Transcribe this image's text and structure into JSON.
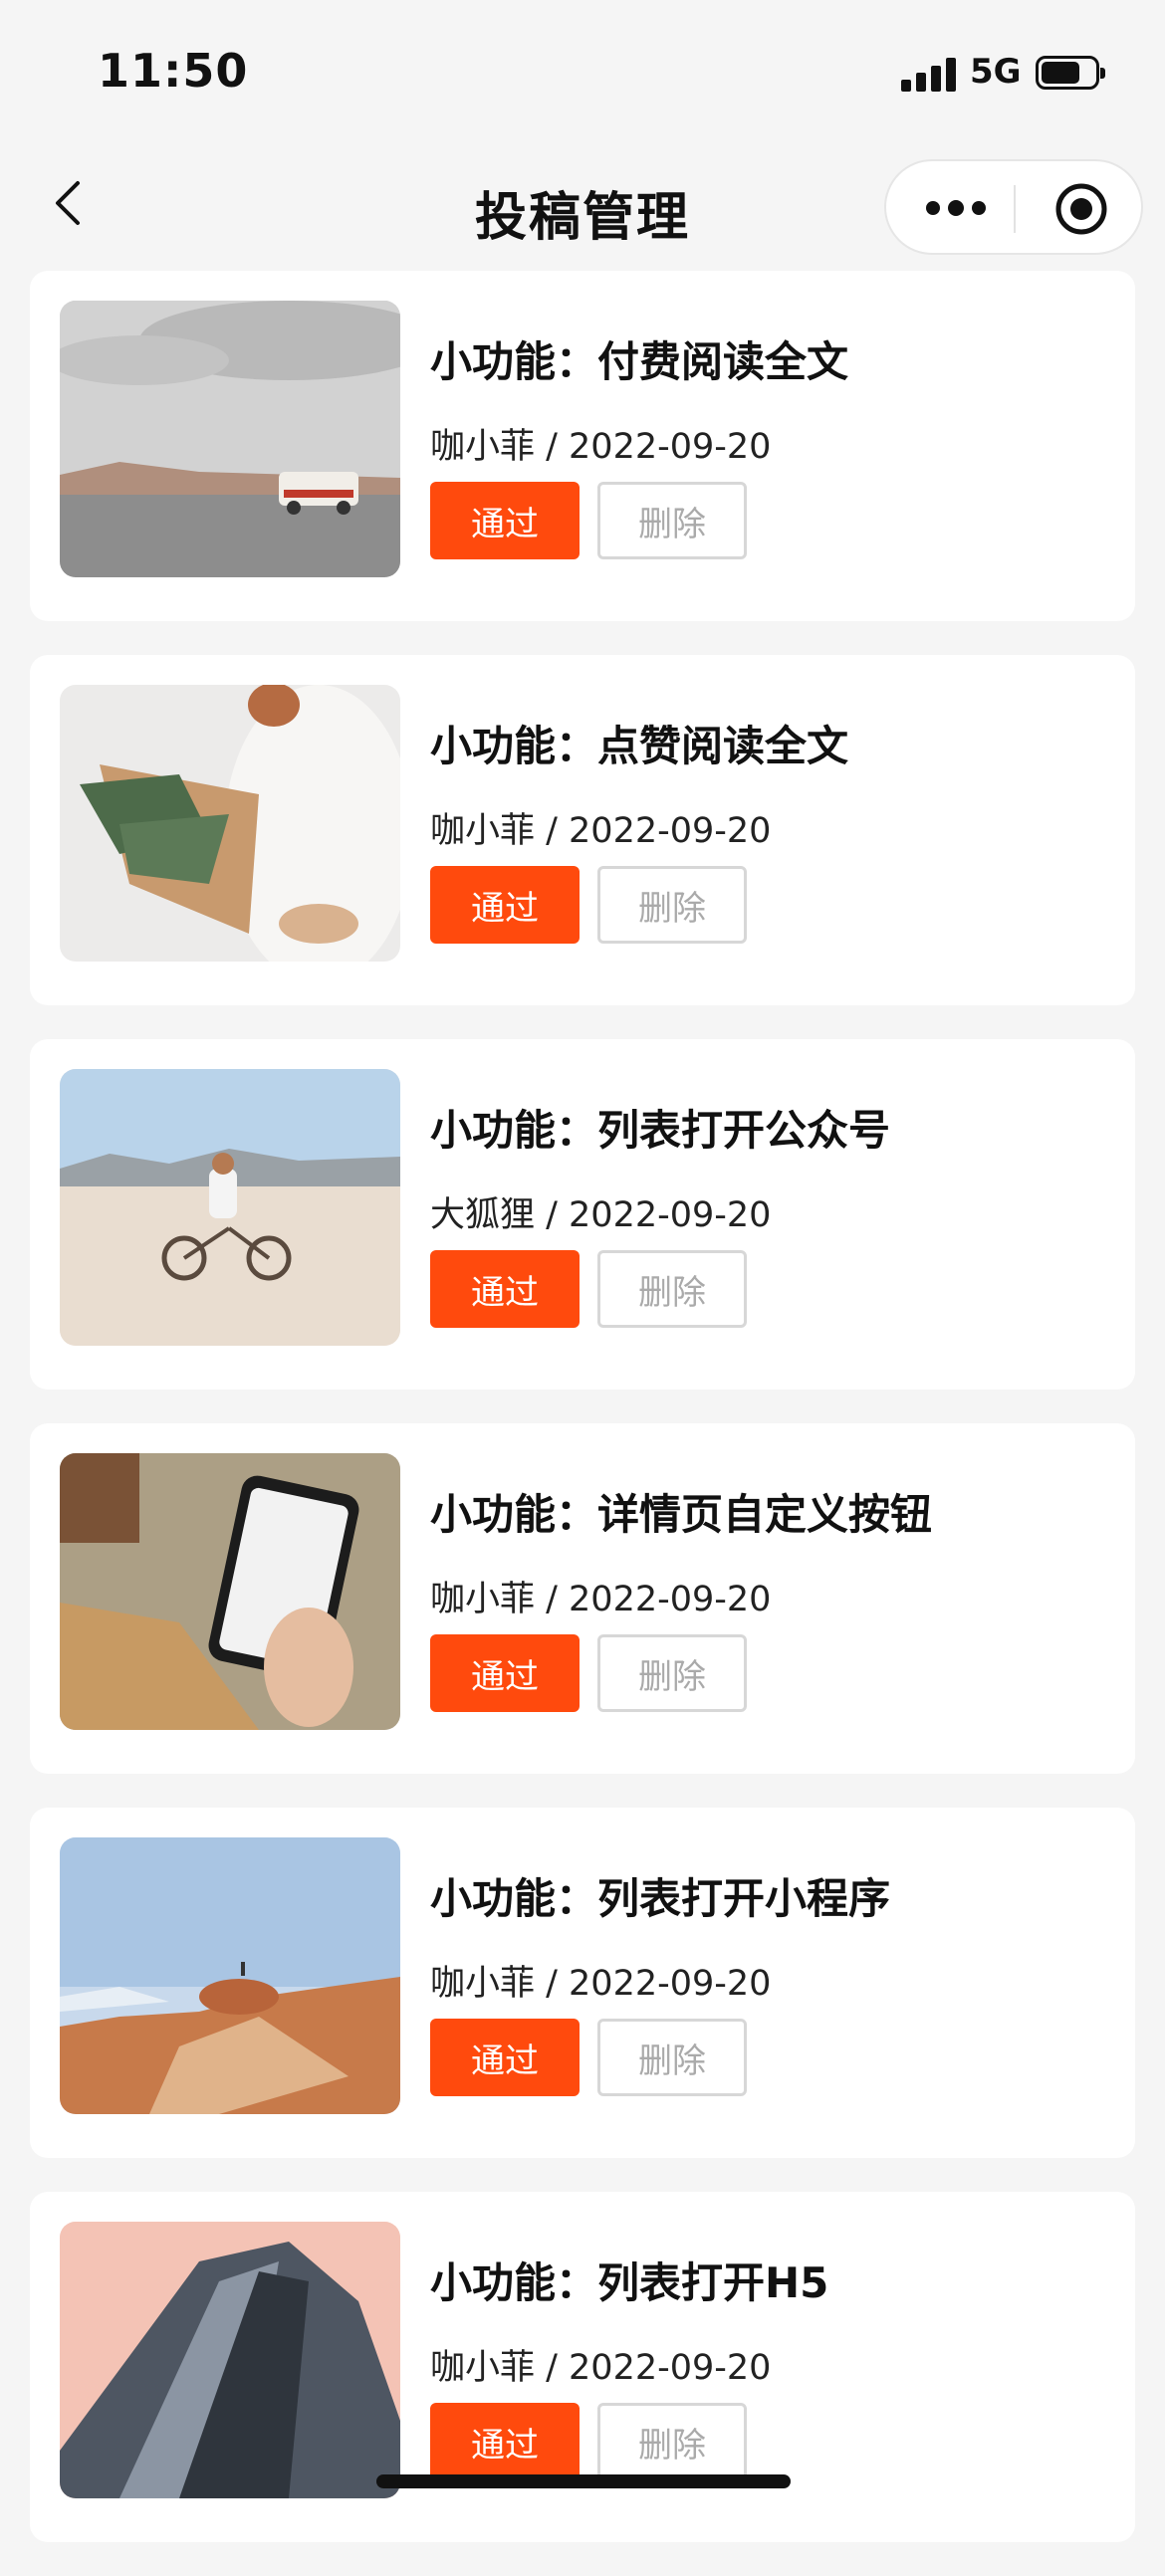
{
  "status_bar": {
    "time": "11:50",
    "network": "5G"
  },
  "nav": {
    "title": "投稿管理"
  },
  "buttons": {
    "approve": "通过",
    "delete": "删除"
  },
  "items": [
    {
      "title": "小功能：付费阅读全文",
      "meta": "咖小菲 / 2022-09-20"
    },
    {
      "title": "小功能：点赞阅读全文",
      "meta": "咖小菲 / 2022-09-20"
    },
    {
      "title": "小功能：列表打开公众号",
      "meta": "大狐狸 / 2022-09-20"
    },
    {
      "title": "小功能：详情页自定义按钮",
      "meta": "咖小菲 / 2022-09-20"
    },
    {
      "title": "小功能：列表打开小程序",
      "meta": "咖小菲 / 2022-09-20"
    },
    {
      "title": "小功能：列表打开H5",
      "meta": "咖小菲 / 2022-09-20"
    }
  ],
  "colors": {
    "accent": "#ff4a0d",
    "background": "#f5f5f5"
  }
}
